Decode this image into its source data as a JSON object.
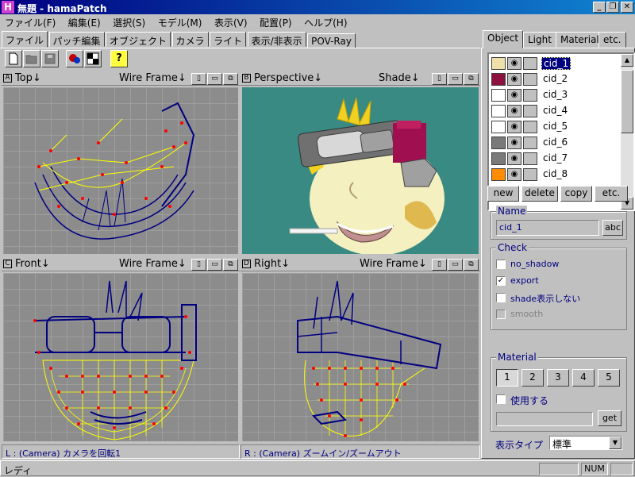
{
  "window": {
    "title": "無題 - hamaPatch",
    "icon_letter": "H",
    "min_label": "_",
    "max_label": "❐",
    "close_label": "✕"
  },
  "menu": [
    "ファイル(F)",
    "編集(E)",
    "選択(S)",
    "モデル(M)",
    "表示(V)",
    "配置(P)",
    "ヘルプ(H)"
  ],
  "tabs": [
    "ファイル",
    "パッチ編集",
    "オブジェクト",
    "カメラ",
    "ライト",
    "表示/非表示",
    "POV-Ray"
  ],
  "toolbar_icons": [
    "new-file-icon",
    "open-folder-icon",
    "save-icon",
    "render-icon",
    "checker-icon",
    "help-icon"
  ],
  "viewports": {
    "top": {
      "letter": "A",
      "name": "Top↓",
      "mode": "Wire Frame↓"
    },
    "perspective": {
      "letter": "B",
      "name": "Perspective↓",
      "mode": "Shade↓"
    },
    "front": {
      "letter": "C",
      "name": "Front↓",
      "mode": "Wire Frame↓"
    },
    "right": {
      "letter": "D",
      "name": "Right↓",
      "mode": "Wire Frame↓"
    },
    "btn_labels": [
      "▯",
      "▭",
      "⧉"
    ]
  },
  "viewport_status": {
    "left": "L : (Camera) カメラを回転1",
    "right": "R : (Camera) ズームイン/ズームアウト"
  },
  "statusbar": {
    "text": "レディ",
    "num": "NUM"
  },
  "panel": {
    "tabs": [
      "Object",
      "Light",
      "Material",
      "etc."
    ],
    "objects": [
      {
        "name": "cid_1",
        "color": "#efdfa8",
        "selected": true
      },
      {
        "name": "cid_2",
        "color": "#8c1040",
        "selected": false
      },
      {
        "name": "cid_3",
        "color": "#ffffff",
        "selected": false
      },
      {
        "name": "cid_4",
        "color": "#ffffff",
        "selected": false
      },
      {
        "name": "cid_5",
        "color": "#ffffff",
        "selected": false
      },
      {
        "name": "cid_6",
        "color": "#7a7a7a",
        "selected": false
      },
      {
        "name": "cid_7",
        "color": "#7a7a7a",
        "selected": false
      },
      {
        "name": "cid_8",
        "color": "#ff8c00",
        "selected": false
      }
    ],
    "eye_glyph": "◉",
    "buttons": {
      "new": "new",
      "delete": "delete",
      "copy": "copy",
      "etc": "etc."
    },
    "name_group": {
      "label": "Name",
      "value": "cid_1",
      "abc": "abc"
    },
    "check_group": {
      "label": "Check",
      "items": [
        {
          "label": "no_shadow",
          "checked": false,
          "disabled": false
        },
        {
          "label": "export",
          "checked": true,
          "disabled": false
        },
        {
          "label": "shade表示しない",
          "checked": false,
          "disabled": false
        },
        {
          "label": "smooth",
          "checked": false,
          "disabled": true
        }
      ],
      "check_glyph": "✓"
    },
    "material_group": {
      "label": "Material",
      "numbers": [
        "1",
        "2",
        "3",
        "4",
        "5"
      ],
      "use_label": "使用する",
      "get": "get"
    },
    "display_type": {
      "label": "表示タイプ",
      "value": "標準"
    }
  }
}
